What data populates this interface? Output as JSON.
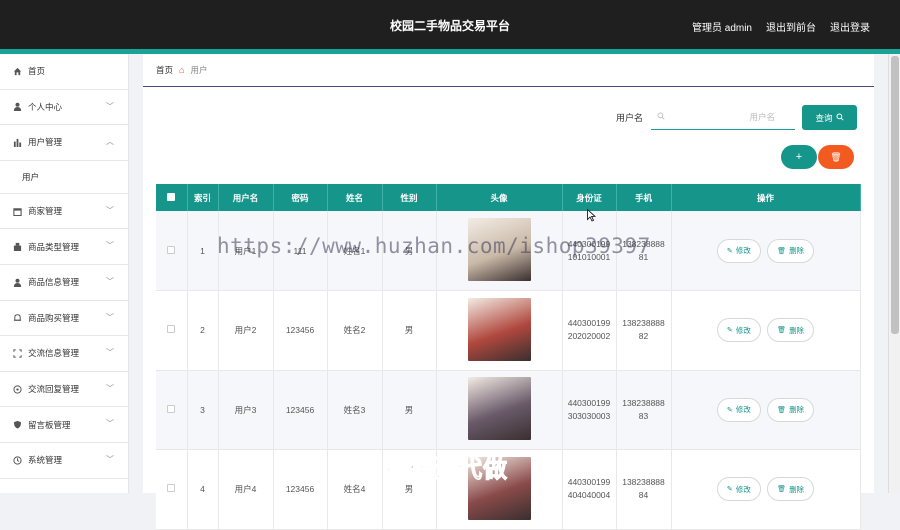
{
  "app": {
    "title": "校园二手物品交易平台",
    "admin_label": "管理员 admin",
    "back_to_front": "退出到前台",
    "logout": "退出登录"
  },
  "sidebar": {
    "items": [
      {
        "label": "首页",
        "icon": "home-icon",
        "expandable": false
      },
      {
        "label": "个人中心",
        "icon": "user-icon",
        "expandable": true
      },
      {
        "label": "用户管理",
        "icon": "chart-icon",
        "expandable": true,
        "expanded": true,
        "children": [
          "用户"
        ]
      },
      {
        "label": "商家管理",
        "icon": "calendar-icon",
        "expandable": true
      },
      {
        "label": "商品类型管理",
        "icon": "building-icon",
        "expandable": true
      },
      {
        "label": "商品信息管理",
        "icon": "user-group-icon",
        "expandable": true
      },
      {
        "label": "商品购买管理",
        "icon": "bell-icon",
        "expandable": true
      },
      {
        "label": "交流信息管理",
        "icon": "scan-icon",
        "expandable": true
      },
      {
        "label": "交流回复管理",
        "icon": "compass-icon",
        "expandable": true
      },
      {
        "label": "留言板管理",
        "icon": "shield-icon",
        "expandable": true
      },
      {
        "label": "系统管理",
        "icon": "clock-icon",
        "expandable": true
      }
    ]
  },
  "breadcrumb": {
    "home": "首页",
    "current": "用户"
  },
  "search": {
    "label": "用户名",
    "placeholder": "用户名",
    "button": "查询"
  },
  "actions": {
    "add": "+",
    "delete": "🗑"
  },
  "table": {
    "headers": [
      "",
      "索引",
      "用户名",
      "密码",
      "姓名",
      "性别",
      "头像",
      "身份证",
      "手机",
      "操作"
    ],
    "rows": [
      {
        "index": "1",
        "username": "用户1",
        "password": "111",
        "name": "姓名1",
        "gender": "男",
        "idcard": "440300199101010001",
        "phone": "13823888881",
        "avatar_color": "#c9b9a8"
      },
      {
        "index": "2",
        "username": "用户2",
        "password": "123456",
        "name": "姓名2",
        "gender": "男",
        "idcard": "440300199202020002",
        "phone": "13823888882",
        "avatar_color": "#b0483e"
      },
      {
        "index": "3",
        "username": "用户3",
        "password": "123456",
        "name": "姓名3",
        "gender": "男",
        "idcard": "440300199303030003",
        "phone": "13823888883",
        "avatar_color": "#6a5a6a"
      },
      {
        "index": "4",
        "username": "用户4",
        "password": "123456",
        "name": "姓名4",
        "gender": "男",
        "idcard": "440300199404040004",
        "phone": "13823888884",
        "avatar_color": "#8a4a4a"
      }
    ],
    "edit_label": "修改",
    "delete_label": "删除"
  },
  "watermark": "https://www.huzhan.com/ishop39397",
  "overlay_text": "专业毕设代做"
}
